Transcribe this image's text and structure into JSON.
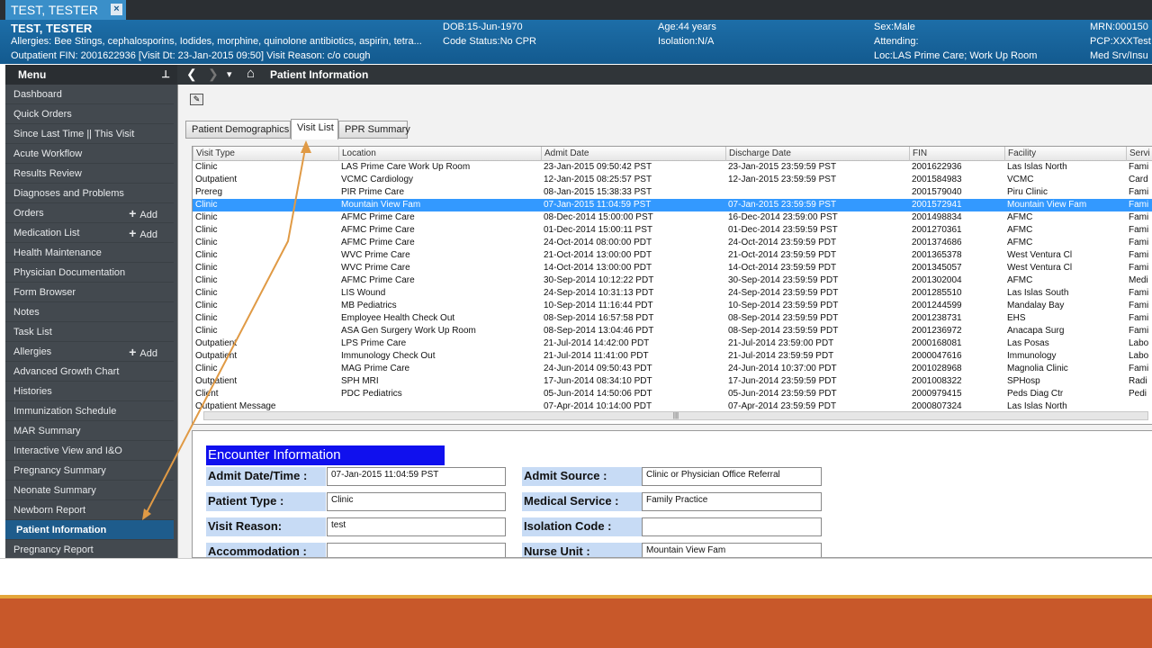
{
  "patient_tab": {
    "name": "TEST, TESTER",
    "close": "×"
  },
  "banner": {
    "name": "TEST, TESTER",
    "allergies": "Allergies: Bee Stings, cephalosporins, Iodides, morphine, quinolone antibiotics, aspirin, tetra...",
    "encounter": "Outpatient FIN: 2001622936 [Visit Dt: 23-Jan-2015 09:50] Visit Reason: c/o cough",
    "dob": "DOB:15-Jun-1970",
    "code_status": "Code Status:No CPR",
    "age": "Age:44 years",
    "isolation": "Isolation:N/A",
    "sex": "Sex:Male",
    "attending": "Attending:",
    "location": "Loc:LAS Prime Care; Work Up Room",
    "mrn": "MRN:000150",
    "pcp": "PCP:XXXTest",
    "med_srv": "Med Srv/Insu"
  },
  "toolbar": {
    "back": "❮",
    "forward": "❯",
    "dropdown": "▾",
    "home": "⌂",
    "title": "Patient Information"
  },
  "menu": {
    "title": "Menu",
    "pin": "⊥",
    "add_label": "Add",
    "add_symbol": "+",
    "items": [
      {
        "label": "Dashboard"
      },
      {
        "label": "Quick Orders"
      },
      {
        "label": "Since Last Time || This Visit"
      },
      {
        "label": "Acute Workflow"
      },
      {
        "label": "Results Review"
      },
      {
        "label": "Diagnoses and Problems"
      },
      {
        "label": "Orders"
      },
      {
        "label": "Medication List"
      },
      {
        "label": "Health Maintenance"
      },
      {
        "label": "Physician Documentation"
      },
      {
        "label": "Form Browser"
      },
      {
        "label": "Notes"
      },
      {
        "label": "Task List"
      },
      {
        "label": "Allergies"
      },
      {
        "label": "Advanced Growth Chart"
      },
      {
        "label": "Histories"
      },
      {
        "label": "Immunization Schedule"
      },
      {
        "label": "MAR Summary"
      },
      {
        "label": "Interactive View and I&O"
      },
      {
        "label": "Pregnancy Summary"
      },
      {
        "label": "Neonate Summary"
      },
      {
        "label": "Newborn Report"
      },
      {
        "label": "Patient Information"
      },
      {
        "label": "Pregnancy Report"
      }
    ]
  },
  "tabs": [
    "Patient Demographics",
    "Visit List",
    "PPR Summary"
  ],
  "visit_table": {
    "columns": [
      "Visit Type",
      "Location",
      "Admit Date",
      "Discharge Date",
      "FIN",
      "Facility",
      "Servi"
    ],
    "rows": [
      [
        "Clinic",
        "LAS Prime Care Work Up Room",
        "23-Jan-2015 09:50:42 PST",
        "23-Jan-2015 23:59:59 PST",
        "2001622936",
        "Las Islas North",
        "Fami"
      ],
      [
        "Outpatient",
        "VCMC Cardiology",
        "12-Jan-2015 08:25:57 PST",
        "12-Jan-2015 23:59:59 PST",
        "2001584983",
        "VCMC",
        "Card"
      ],
      [
        "Prereg",
        "PIR Prime Care",
        "08-Jan-2015 15:38:33 PST",
        "",
        "2001579040",
        "Piru Clinic",
        "Fami"
      ],
      [
        "Clinic",
        "Mountain View Fam",
        "07-Jan-2015 11:04:59 PST",
        "07-Jan-2015 23:59:59 PST",
        "2001572941",
        "Mountain View Fam",
        "Fami"
      ],
      [
        "Clinic",
        "AFMC Prime Care",
        "08-Dec-2014 15:00:00 PST",
        "16-Dec-2014 23:59:00 PST",
        "2001498834",
        "AFMC",
        "Fami"
      ],
      [
        "Clinic",
        "AFMC Prime Care",
        "01-Dec-2014 15:00:11 PST",
        "01-Dec-2014 23:59:59 PST",
        "2001270361",
        "AFMC",
        "Fami"
      ],
      [
        "Clinic",
        "AFMC Prime Care",
        "24-Oct-2014 08:00:00 PDT",
        "24-Oct-2014 23:59:59 PDT",
        "2001374686",
        "AFMC",
        "Fami"
      ],
      [
        "Clinic",
        "WVC Prime Care",
        "21-Oct-2014 13:00:00 PDT",
        "21-Oct-2014 23:59:59 PDT",
        "2001365378",
        "West Ventura Cl",
        "Fami"
      ],
      [
        "Clinic",
        "WVC Prime Care",
        "14-Oct-2014 13:00:00 PDT",
        "14-Oct-2014 23:59:59 PDT",
        "2001345057",
        "West Ventura Cl",
        "Fami"
      ],
      [
        "Clinic",
        "AFMC Prime Care",
        "30-Sep-2014 10:12:22 PDT",
        "30-Sep-2014 23:59:59 PDT",
        "2001302004",
        "AFMC",
        "Medi"
      ],
      [
        "Clinic",
        "LIS Wound",
        "24-Sep-2014 10:31:13 PDT",
        "24-Sep-2014 23:59:59 PDT",
        "2001285510",
        "Las Islas South",
        "Fami"
      ],
      [
        "Clinic",
        "MB Pediatrics",
        "10-Sep-2014 11:16:44 PDT",
        "10-Sep-2014 23:59:59 PDT",
        "2001244599",
        "Mandalay Bay",
        "Fami"
      ],
      [
        "Clinic",
        "Employee Health Check Out",
        "08-Sep-2014 16:57:58 PDT",
        "08-Sep-2014 23:59:59 PDT",
        "2001238731",
        "EHS",
        "Fami"
      ],
      [
        "Clinic",
        "ASA Gen Surgery Work Up Room",
        "08-Sep-2014 13:04:46 PDT",
        "08-Sep-2014 23:59:59 PDT",
        "2001236972",
        "Anacapa Surg",
        "Fami"
      ],
      [
        "Outpatient",
        "LPS Prime Care",
        "21-Jul-2014 14:42:00 PDT",
        "21-Jul-2014 23:59:00 PDT",
        "2000168081",
        "Las Posas",
        "Labo"
      ],
      [
        "Outpatient",
        "Immunology Check Out",
        "21-Jul-2014 11:41:00 PDT",
        "21-Jul-2014 23:59:59 PDT",
        "2000047616",
        "Immunology",
        "Labo"
      ],
      [
        "Clinic",
        "MAG Prime Care",
        "24-Jun-2014 09:50:43 PDT",
        "24-Jun-2014 10:37:00 PDT",
        "2001028968",
        "Magnolia Clinic",
        "Fami"
      ],
      [
        "Outpatient",
        "SPH MRI",
        "17-Jun-2014 08:34:10 PDT",
        "17-Jun-2014 23:59:59 PDT",
        "2001008322",
        "SPHosp",
        "Radi"
      ],
      [
        "Client",
        "PDC Pediatrics",
        "05-Jun-2014 14:50:06 PDT",
        "05-Jun-2014 23:59:59 PDT",
        "2000979415",
        "Peds Diag Ctr",
        "Pedi"
      ],
      [
        "Outpatient Message",
        "",
        "07-Apr-2014 10:14:00 PDT",
        "07-Apr-2014 23:59:59 PDT",
        "2000807324",
        "Las Islas North",
        ""
      ]
    ],
    "scroll_grip": "|||"
  },
  "encounter": {
    "title": "Encounter Information",
    "admit_date_label": "Admit Date/Time :",
    "admit_date_value": "07-Jan-2015 11:04:59 PST",
    "admit_source_label": "Admit Source :",
    "admit_source_value": "Clinic or Physician Office Referral",
    "patient_type_label": "Patient Type :",
    "patient_type_value": "Clinic",
    "medical_service_label": "Medical Service :",
    "medical_service_value": "Family Practice",
    "visit_reason_label": "Visit Reason:",
    "visit_reason_value": "test",
    "isolation_code_label": "Isolation Code :",
    "isolation_code_value": "",
    "accommodation_label": "Accommodation :",
    "accommodation_value": "",
    "nurse_unit_label": "Nurse Unit :",
    "nurse_unit_value": "Mountain View Fam"
  },
  "colors": {
    "selection": "#3399ff",
    "banner": "#1d6ea8",
    "annotation_arrow": "#e09a45",
    "encounter_title_bg": "#1010ee",
    "bottom_bar": "#c8582a"
  }
}
